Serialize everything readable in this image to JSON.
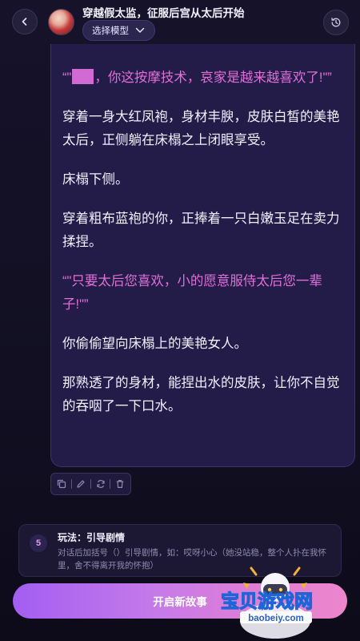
{
  "header": {
    "title": "穿越假太监，征服后宫从太后开始",
    "model_button": "选择模型",
    "icons": {
      "back": "chevron-left-icon",
      "history": "history-icon",
      "model": "chevron-down-icon"
    }
  },
  "story": {
    "paragraphs": [
      {
        "type": "dialog",
        "before": "“\"",
        "after": "，你这按摩技术，哀家是越来越喜欢了!\"”"
      },
      {
        "type": "narration",
        "text": "穿着一身大红凤袍，身材丰腴，皮肤白皙的美艳太后，正侧躺在床榻之上闭眼享受。"
      },
      {
        "type": "narration",
        "text": "床榻下侧。"
      },
      {
        "type": "narration",
        "text": "穿着粗布蓝袍的你，正捧着一只白嫩玉足在卖力揉捏。"
      },
      {
        "type": "dialog",
        "text": "“\"只要太后您喜欢，小的愿意服侍太后您一辈子!\"”"
      },
      {
        "type": "narration",
        "text": "你偷偷望向床榻上的美艳女人。"
      },
      {
        "type": "narration",
        "text": "那熟透了的身材，能捏出水的皮肤，让你不自觉的吞咽了一下口水。"
      }
    ],
    "colors": {
      "narration": "#f1efff",
      "dialog": "#e06fd8"
    }
  },
  "actions": [
    "copy-icon",
    "edit-icon",
    "refresh-icon",
    "delete-icon"
  ],
  "tip": {
    "number": "5",
    "title": "玩法：引导剧情",
    "description": "对话后加括号（）引导剧情，如：哎呀小心（她没站稳，整个人扑在我怀里，舍不得离开我的怀抱）"
  },
  "start_button": "开启新故事",
  "watermark": {
    "brand": "宝贝游戏网",
    "url": "baobeiy.com"
  }
}
